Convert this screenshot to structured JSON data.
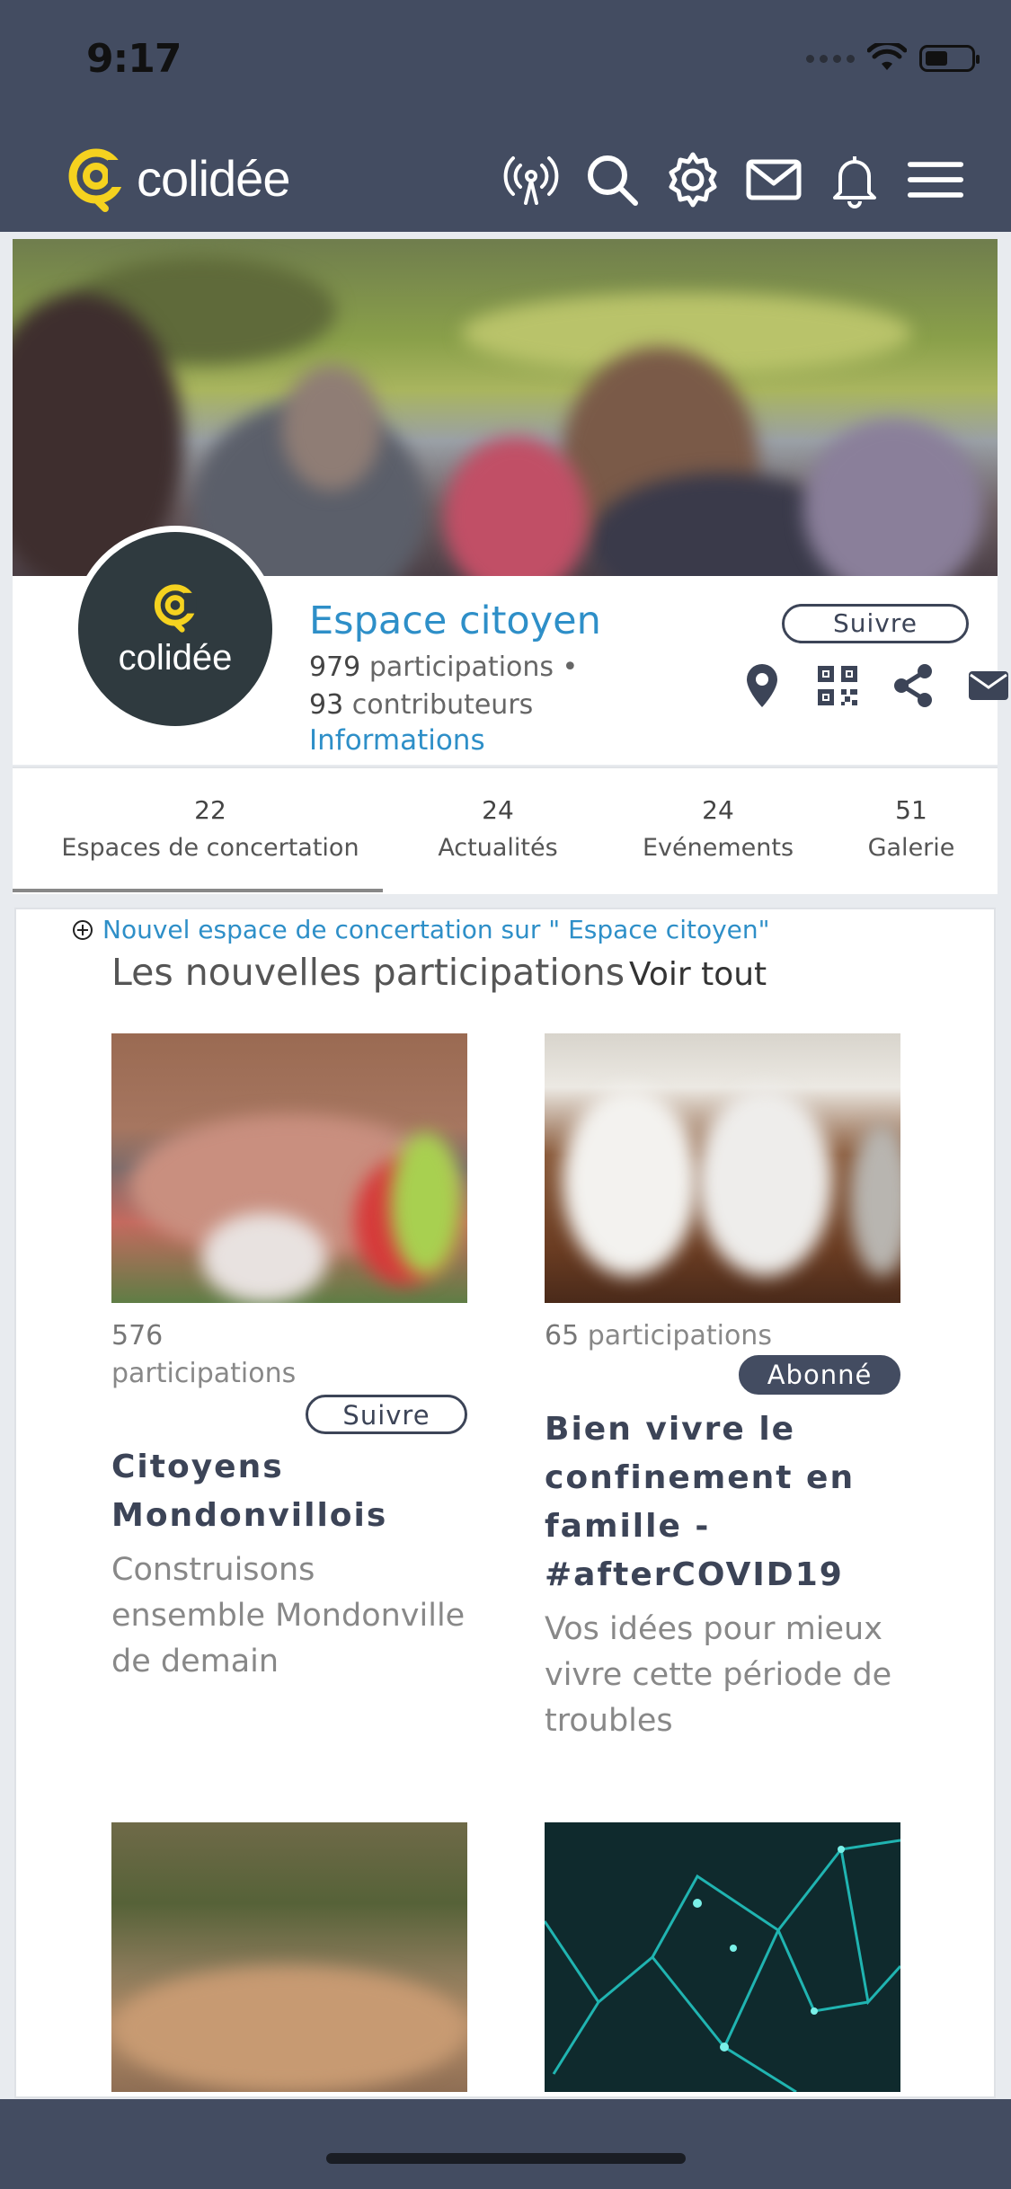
{
  "status": {
    "time": "9:17"
  },
  "app": {
    "name": "colidée"
  },
  "nav_icons": [
    "broadcast-icon",
    "search-icon",
    "gear-icon",
    "mail-icon",
    "bell-icon",
    "menu-icon"
  ],
  "space": {
    "title": "Espace citoyen",
    "participations_count": "979",
    "participations_label": "participations •",
    "contributors_count": "93",
    "contributors_label": "contributeurs",
    "info_link": "Informations",
    "follow_label": "Suivre",
    "avatar_text": "colidée"
  },
  "tabs": [
    {
      "count": "22",
      "label": "Espaces de concertation"
    },
    {
      "count": "24",
      "label": "Actualités"
    },
    {
      "count": "24",
      "label": "Evénements"
    },
    {
      "count": "51",
      "label": "Galerie"
    }
  ],
  "content": {
    "new_space_link": "Nouvel espace de concertation sur \" Espace citoyen\"",
    "section_title": "Les nouvelles participations",
    "see_all": "Voir tout"
  },
  "cards": [
    {
      "count": "576",
      "count_label": "participations",
      "button": "Suivre",
      "title": "Citoyens Mondonvillois",
      "desc": "Construisons ensemble Mondonville de demain"
    },
    {
      "count": "65",
      "count_label": "participations",
      "button": "Abonné",
      "title": "Bien vivre le confinement en famille - #afterCOVID19",
      "desc": "Vos idées pour mieux vivre cette période de troubles"
    }
  ],
  "colors": {
    "topbar": "#434c61",
    "accent": "#2e8fc8",
    "logo": "#f5d21f"
  }
}
